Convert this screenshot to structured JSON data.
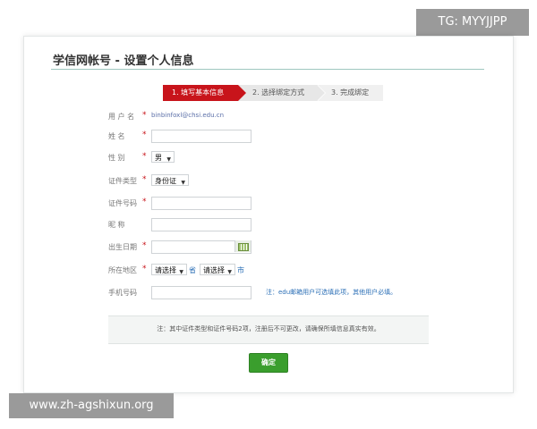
{
  "watermark_top": "TG: MYYJJPP",
  "watermark_bottom": "www.zh-agshixun.org",
  "page_title": "学信网帐号 - 设置个人信息",
  "steps": [
    {
      "label": "1. 填写基本信息"
    },
    {
      "label": "2. 选择绑定方式"
    },
    {
      "label": "3. 完成绑定"
    }
  ],
  "required_mark": "*",
  "form": {
    "username": {
      "label": "用 户 名",
      "value": "binbinfoxl@chsi.edu.cn"
    },
    "name": {
      "label": "姓    名",
      "value": ""
    },
    "gender": {
      "label": "性    别",
      "value": "男"
    },
    "id_type": {
      "label": "证件类型",
      "value": "身份证"
    },
    "id_number": {
      "label": "证件号码",
      "value": ""
    },
    "nickname": {
      "label": "昵    称",
      "value": ""
    },
    "birthdate": {
      "label": "出生日期",
      "value": ""
    },
    "region": {
      "label": "所在地区",
      "province_value": "请选择",
      "province_unit": "省",
      "city_value": "请选择",
      "city_unit": "市"
    },
    "phone": {
      "label": "手机号码",
      "value": "",
      "hint": "注：edu邮箱用户可选填此项，其他用户必填。"
    }
  },
  "notice": "注：其中证件类型和证件号码2项，注册后不可更改，请确保所填信息真实有效。",
  "submit_label": "确定",
  "colors": {
    "accent": "#c8141b",
    "button": "#3a9e2d",
    "link": "#2b6fb6"
  }
}
